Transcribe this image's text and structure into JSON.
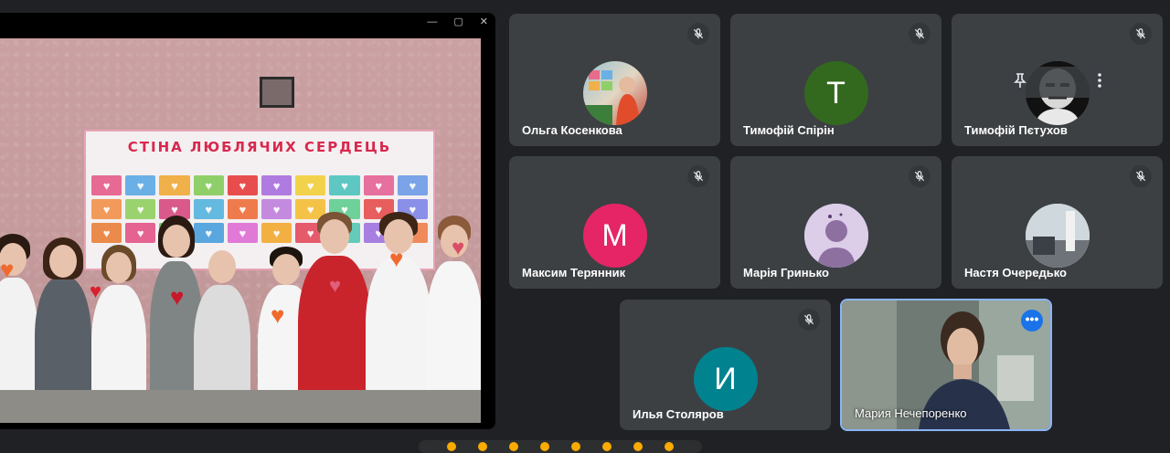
{
  "share_window": {
    "controls": [
      "—",
      "▢",
      "✕"
    ],
    "poster_title": "СТІНА ЛЮБЛЯЧИХ СЕРДЕЦЬ"
  },
  "participants": [
    {
      "name": "Ольга Косенкова",
      "avatar_type": "photo",
      "muted": true
    },
    {
      "name": "Тимофій Спірін",
      "avatar_type": "letter",
      "letter": "Т",
      "color": "#33691e",
      "muted": true
    },
    {
      "name": "Тимофій Пєтухов",
      "avatar_type": "photo",
      "muted": true
    },
    {
      "name": "Максим Терянник",
      "avatar_type": "letter",
      "letter": "М",
      "color": "#e52565",
      "muted": true
    },
    {
      "name": "Марія Гринько",
      "avatar_type": "photo",
      "muted": true
    },
    {
      "name": "Настя Очередько",
      "avatar_type": "photo",
      "muted": true
    },
    {
      "name": "Илья Столяров",
      "avatar_type": "letter",
      "letter": "И",
      "color": "#00838f",
      "muted": true
    },
    {
      "name": "Мария Нечепоренко",
      "avatar_type": "video",
      "muted": false
    }
  ],
  "pin_pill": {
    "pin_icon": "pin-icon",
    "menu_icon": "more-vert-icon"
  },
  "more_options_glyph": "•••",
  "colors": {
    "background": "#202124",
    "tile": "#3c4043",
    "active_border": "#8ab4f8",
    "accent": "#1a73e8"
  }
}
